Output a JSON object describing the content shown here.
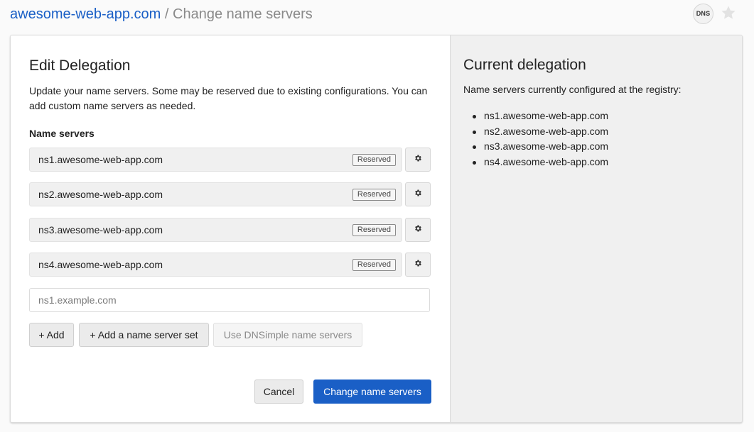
{
  "header": {
    "domain": "awesome-web-app.com",
    "separator": "/",
    "page": "Change name servers",
    "badge": "DNS",
    "star_icon": "star-icon"
  },
  "edit": {
    "title": "Edit Delegation",
    "description": "Update your name servers. Some may be reserved due to existing configurations. You can add custom name servers as needed.",
    "label": "Name servers",
    "name_servers": [
      {
        "value": "ns1.awesome-web-app.com",
        "badge": "Reserved",
        "icon": "gear-icon"
      },
      {
        "value": "ns2.awesome-web-app.com",
        "badge": "Reserved",
        "icon": "gear-icon"
      },
      {
        "value": "ns3.awesome-web-app.com",
        "badge": "Reserved",
        "icon": "gear-icon"
      },
      {
        "value": "ns4.awesome-web-app.com",
        "badge": "Reserved",
        "icon": "gear-icon"
      }
    ],
    "new_input": {
      "value": "",
      "placeholder": "ns1.example.com"
    },
    "buttons": {
      "add": "+ Add",
      "add_set": "+ Add a name server set",
      "use_dnsimple": "Use DNSimple name servers",
      "cancel": "Cancel",
      "submit": "Change name servers"
    }
  },
  "current": {
    "title": "Current delegation",
    "description": "Name servers currently configured at the registry:",
    "items": [
      "ns1.awesome-web-app.com",
      "ns2.awesome-web-app.com",
      "ns3.awesome-web-app.com",
      "ns4.awesome-web-app.com"
    ]
  },
  "colors": {
    "primary": "#1a5fc6",
    "muted_text": "#8a8a8a",
    "page_background": "#fafafa",
    "side_panel": "#f0f0f0"
  }
}
